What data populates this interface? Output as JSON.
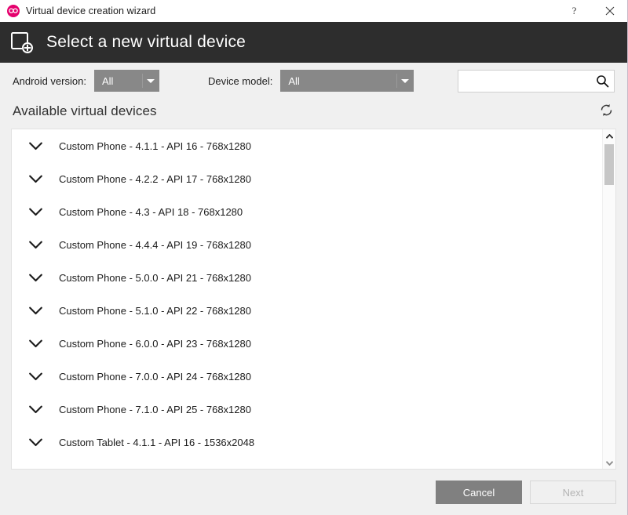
{
  "colors": {
    "header_bg": "#2d2d2d",
    "page_bg": "#f0f0f0",
    "combo_bg": "#888888",
    "cancel_bg": "#808080",
    "logo_pink": "#e5006d",
    "scroll_thumb": "#c6c6c6"
  },
  "titlebar": {
    "title": "Virtual device creation wizard",
    "logo_icon": "genymotion-logo-icon",
    "help_label": "?",
    "close_icon": "close-icon"
  },
  "wizard_header": {
    "icon": "add-device-icon",
    "title": "Select a new virtual device"
  },
  "filters": {
    "android_version": {
      "label": "Android version:",
      "value": "All",
      "caret_icon": "chevron-down-icon"
    },
    "device_model": {
      "label": "Device model:",
      "value": "All",
      "caret_icon": "chevron-down-icon"
    },
    "search": {
      "value": "",
      "placeholder": "",
      "icon": "search-icon"
    }
  },
  "section": {
    "title": "Available virtual devices",
    "refresh_icon": "refresh-icon"
  },
  "device_list": {
    "expand_icon": "chevron-down-icon",
    "items": [
      {
        "label": "Custom Phone - 4.1.1 - API 16 - 768x1280"
      },
      {
        "label": "Custom Phone - 4.2.2 - API 17 - 768x1280"
      },
      {
        "label": "Custom Phone - 4.3 - API 18 - 768x1280"
      },
      {
        "label": "Custom Phone - 4.4.4 - API 19 - 768x1280"
      },
      {
        "label": "Custom Phone - 5.0.0 - API 21 - 768x1280"
      },
      {
        "label": "Custom Phone - 5.1.0 - API 22 - 768x1280"
      },
      {
        "label": "Custom Phone - 6.0.0 - API 23 - 768x1280"
      },
      {
        "label": "Custom Phone - 7.0.0 - API 24 - 768x1280"
      },
      {
        "label": "Custom Phone - 7.1.0 - API 25 - 768x1280"
      },
      {
        "label": "Custom Tablet - 4.1.1 - API 16 - 1536x2048"
      }
    ]
  },
  "scrollbar": {
    "up_icon": "scroll-up-arrow-icon",
    "down_icon": "scroll-down-arrow-icon"
  },
  "footer": {
    "cancel_label": "Cancel",
    "next_label": "Next"
  }
}
